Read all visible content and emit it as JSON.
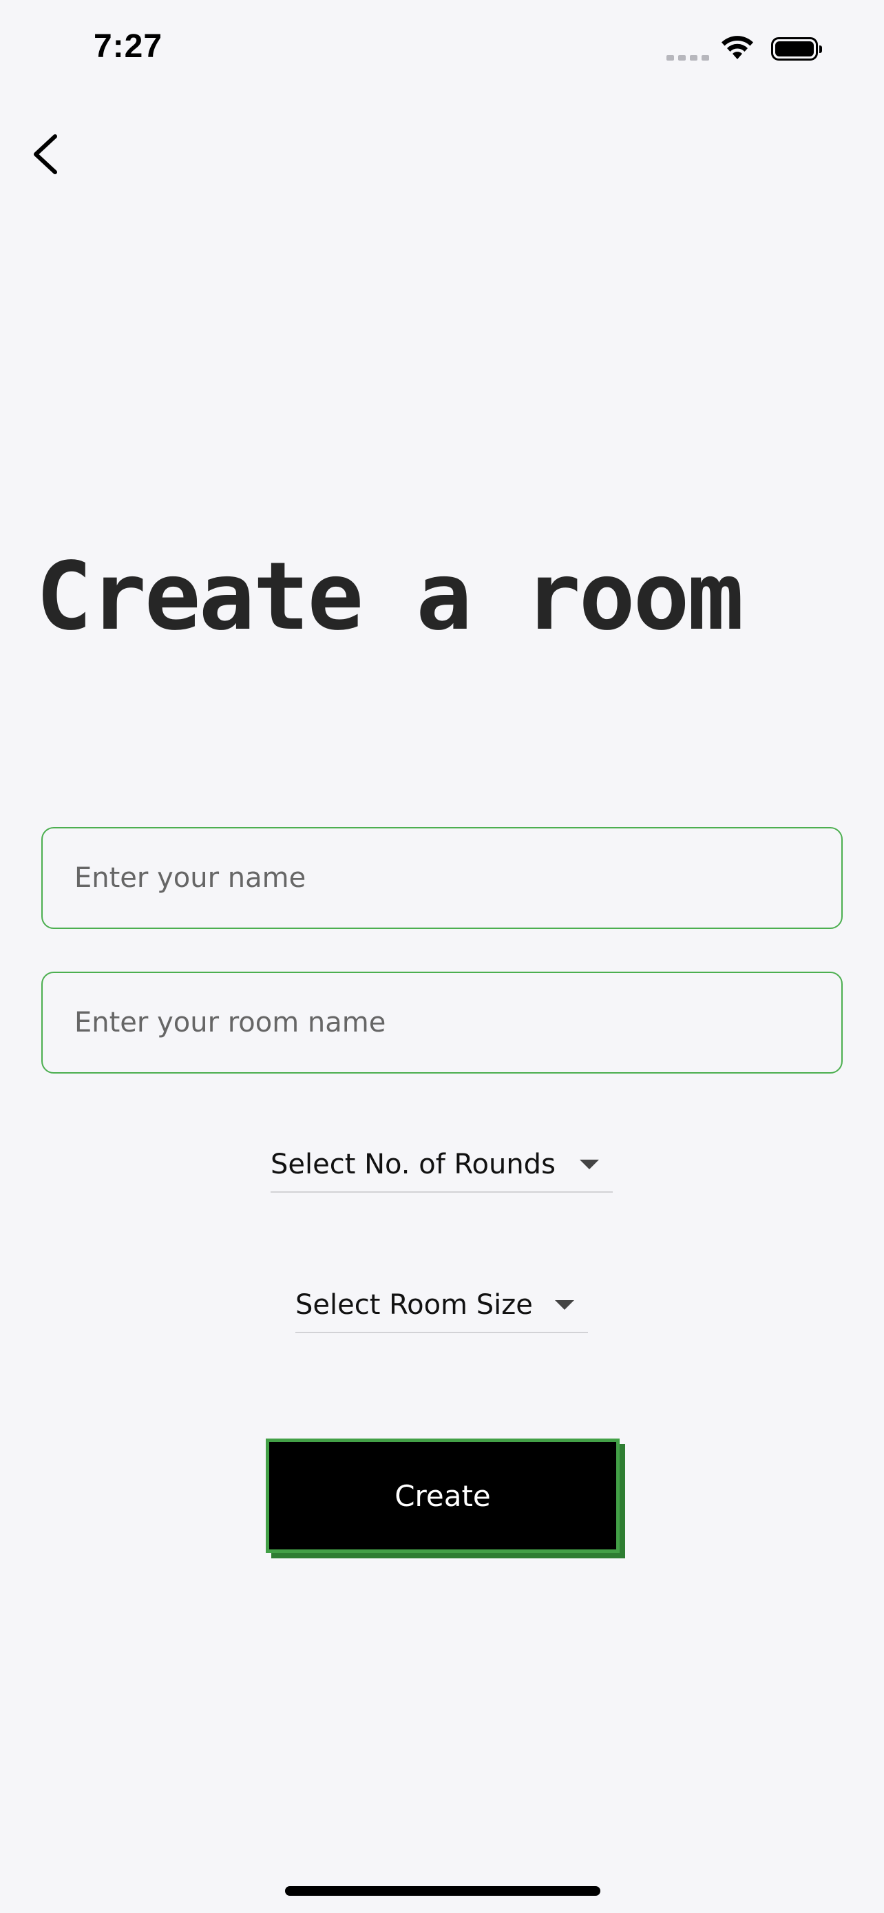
{
  "status_bar": {
    "time": "7:27"
  },
  "nav": {
    "back_icon": "chevron-left-icon"
  },
  "title": "Create a room",
  "form": {
    "name_placeholder": "Enter your name",
    "name_value": "",
    "room_placeholder": "Enter your room name",
    "room_value": "",
    "rounds_dropdown_label": "Select No. of Rounds",
    "room_size_dropdown_label": "Select Room Size",
    "create_label": "Create"
  },
  "colors": {
    "background": "#f6f6f9",
    "accent_green": "#4caf50",
    "button_bg": "#000000",
    "button_text": "#ffffff"
  }
}
